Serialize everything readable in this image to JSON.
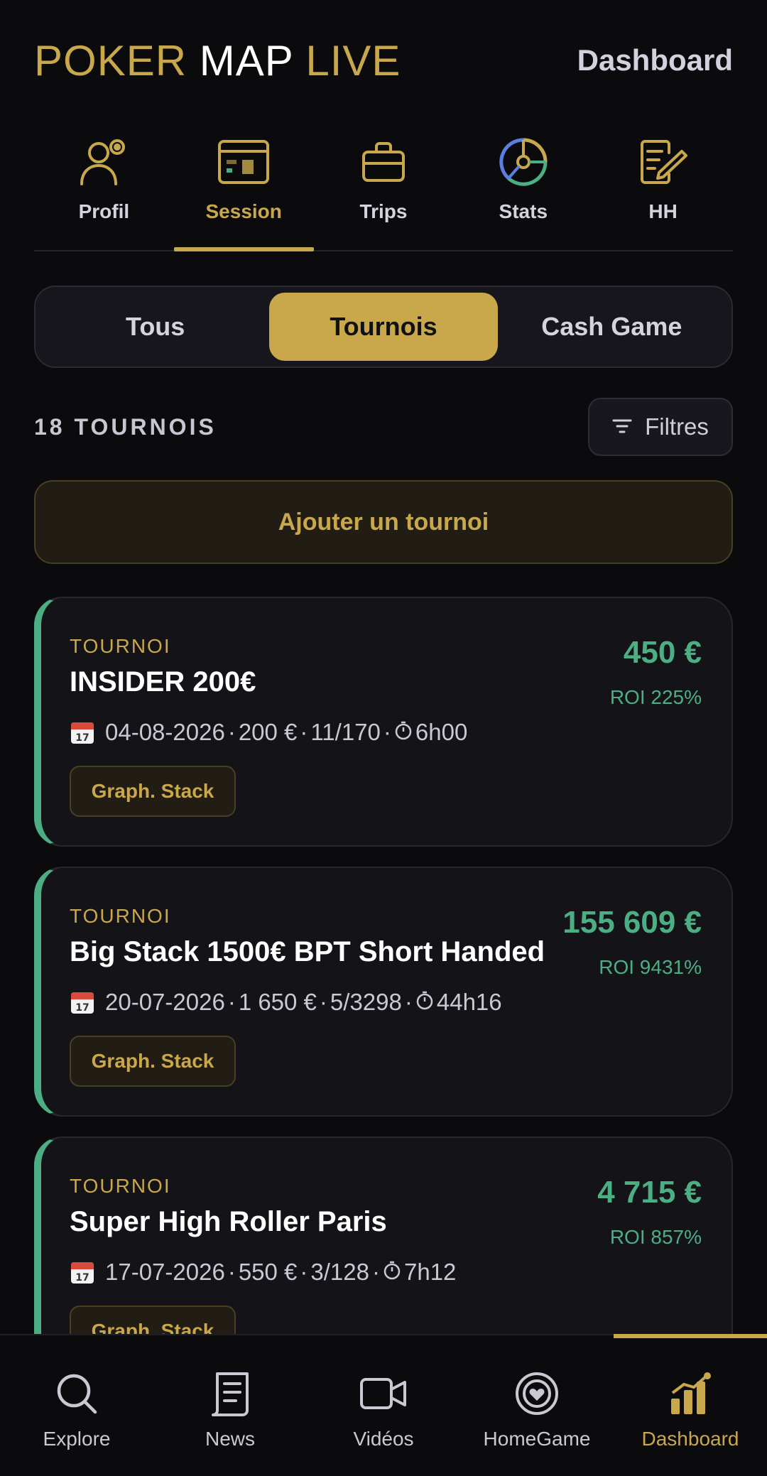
{
  "header": {
    "brand_part1": "POKER",
    "brand_part2": "MAP",
    "brand_part3": "LIVE",
    "dashboard_link": "Dashboard"
  },
  "top_tabs": [
    {
      "label": "Profil",
      "icon": "user-icon",
      "active": false
    },
    {
      "label": "Session",
      "icon": "session-card-icon",
      "active": true
    },
    {
      "label": "Trips",
      "icon": "briefcase-icon",
      "active": false
    },
    {
      "label": "Stats",
      "icon": "pie-chart-icon",
      "active": false
    },
    {
      "label": "HH",
      "icon": "notes-edit-icon",
      "active": false
    }
  ],
  "segment": {
    "options": [
      "Tous",
      "Tournois",
      "Cash Game"
    ],
    "selected": "Tournois"
  },
  "list": {
    "count_label": "18 TOURNOIS",
    "filter_label": "Filtres",
    "add_label": "Ajouter un tournoi"
  },
  "cards": [
    {
      "kind": "TOURNOI",
      "title": "INSIDER 200€",
      "date": "04-08-2026",
      "buyin": "200 €",
      "rank": "11/170",
      "duration": "6h00",
      "gain": "450 €",
      "roi": "ROI 225%",
      "graph_label": "Graph. Stack"
    },
    {
      "kind": "TOURNOI",
      "title": "Big Stack 1500€ BPT Short Handed",
      "date": "20-07-2026",
      "buyin": "1 650 €",
      "rank": "5/3298",
      "duration": "44h16",
      "gain": "155 609 €",
      "roi": "ROI 9431%",
      "graph_label": "Graph. Stack"
    },
    {
      "kind": "TOURNOI",
      "title": "Super High Roller Paris",
      "date": "17-07-2026",
      "buyin": "550 €",
      "rank": "3/128",
      "duration": "7h12",
      "gain": "4 715 €",
      "roi": "ROI 857%",
      "graph_label": "Graph. Stack"
    }
  ],
  "meta_separator": "·",
  "bottom_nav": [
    {
      "label": "Explore",
      "icon": "search-icon",
      "active": false
    },
    {
      "label": "News",
      "icon": "news-icon",
      "active": false
    },
    {
      "label": "Vidéos",
      "icon": "video-icon",
      "active": false
    },
    {
      "label": "HomeGame",
      "icon": "poker-chip-icon",
      "active": false
    },
    {
      "label": "Dashboard",
      "icon": "dashboard-chart-icon",
      "active": true
    }
  ],
  "colors": {
    "gold": "#c9a84c",
    "green": "#4caf84",
    "background": "#0b0b0e"
  }
}
